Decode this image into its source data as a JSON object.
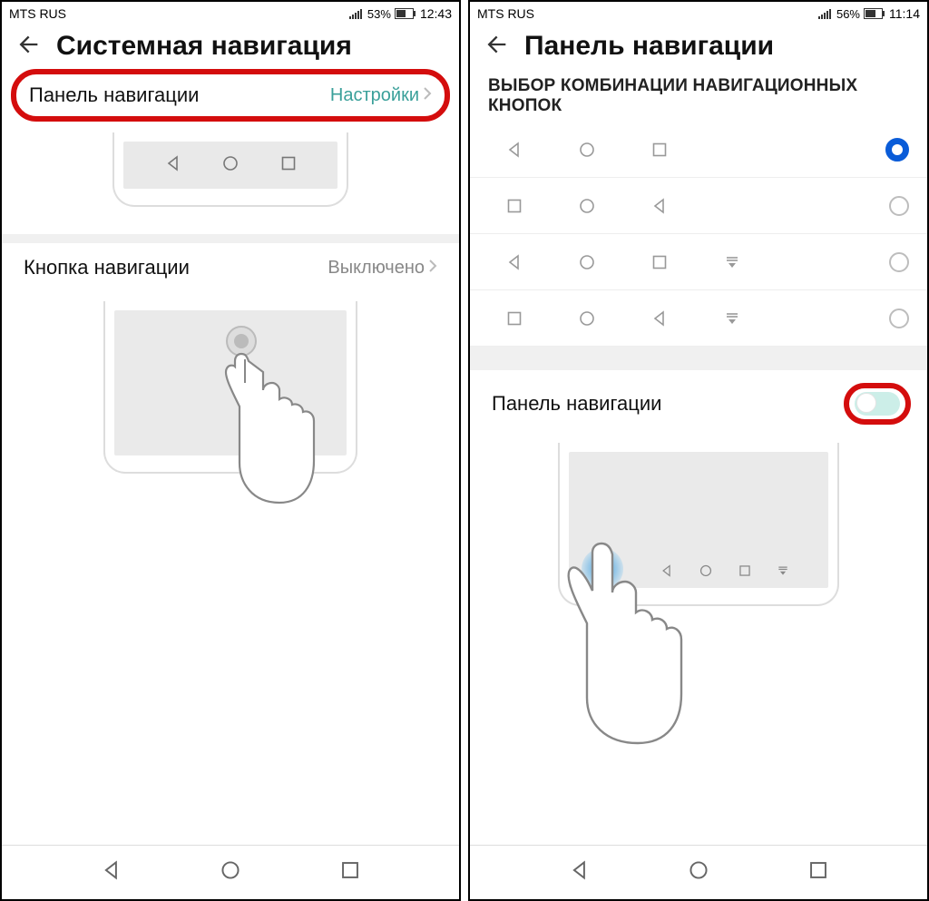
{
  "left": {
    "carrier": "MTS RUS",
    "battery": "53%",
    "time": "12:43",
    "title": "Системная навигация",
    "row1": {
      "label": "Панель навигации",
      "value": "Настройки"
    },
    "row2": {
      "label": "Кнопка навигации",
      "value": "Выключено"
    }
  },
  "right": {
    "carrier": "MTS RUS",
    "battery": "56%",
    "time": "11:14",
    "title": "Панель навигации",
    "section_header": "ВЫБОР КОМБИНАЦИИ НАВИГАЦИОННЫХ КНОПОК",
    "toggle_label": "Панель навигации"
  }
}
